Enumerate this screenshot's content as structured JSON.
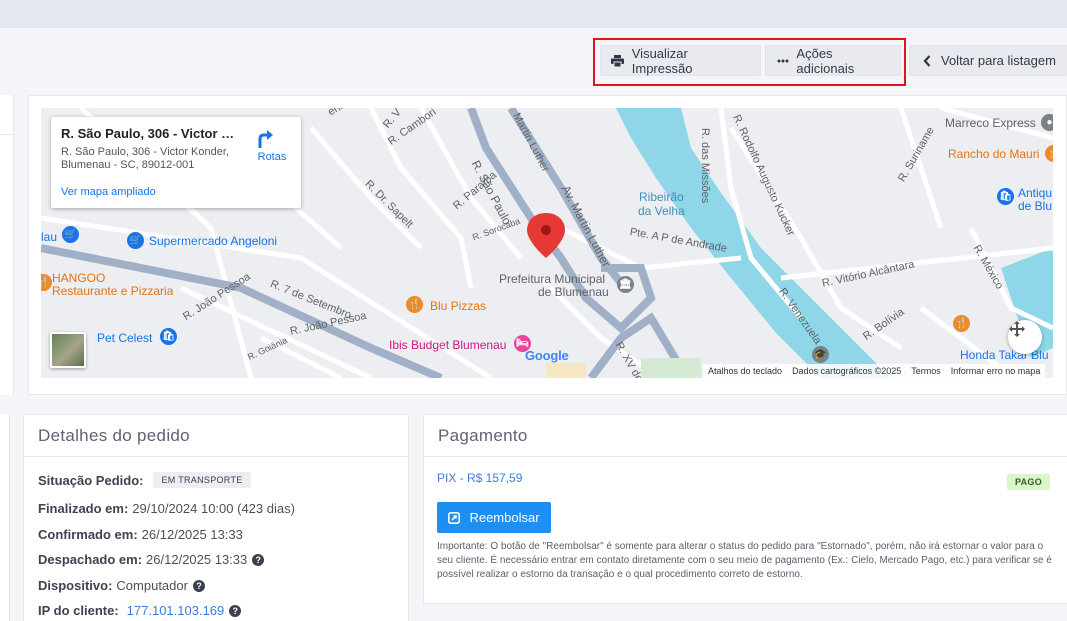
{
  "toolbar": {
    "print_label": "Visualizar Impressão",
    "actions_label": "Ações adicionais",
    "back_label": "Voltar para listagem",
    "highlight_color": "#e0121b"
  },
  "map": {
    "info": {
      "title": "R. São Paulo, 306 - Victor Kon...",
      "address": "R. São Paulo, 306 - Victor Konder, Blumenau - SC, 89012-001",
      "larger_map_link": "Ver mapa ampliado",
      "route_label": "Rotas"
    },
    "labels": {
      "supermercado": "Supermercado Angeloni",
      "hangoo_1": "HANGOO",
      "hangoo_2": "Restaurante e Pizzaria",
      "pet": "Pet Celest",
      "blu_pizzas": "Blu Pizzas",
      "ibis": "Ibis Budget Blumenau",
      "prefeitura_1": "Prefeitura Municipal",
      "prefeitura_2": "de Blumenau",
      "ribeirao_1": "Ribeirão",
      "ribeirao_2": "da Velha",
      "marreco": "Marreco Express",
      "rancho": "Rancho do Mauri",
      "antiq_1": "Antiqu",
      "antiq_2": "de Blu",
      "honda": "Honda Takar Blu",
      "lau": "lau"
    },
    "streets": {
      "sao_paulo": "R. São Paulo",
      "martin": "Av. Martin Luther",
      "martin2": "Martin Luther",
      "ap_andrade": "Pte. A P de Andrade",
      "sete_setembro": "R. 7 de Setembro",
      "joao_pessoa": "R. João Pessoa",
      "joao_pessoa2": "R. João Pessoa",
      "goiania": "R. Goiânia",
      "sorocaba": "R. Sorocaba",
      "paraiba": "R. Paraíba",
      "sapelt": "R. Dr. Sapelt",
      "cambori": "R. Cambori",
      "missoes": "R. das Missões",
      "rodolfo": "R. Rodolfo Augusto Kucker",
      "vitorio": "R. Vitório Alcântara",
      "venezuela": "R. Venezuela",
      "bolivia": "R. Bolívia",
      "suriname": "R. Suriname",
      "mexico": "R. México",
      "xv": "R. XV de",
      "hering": "ering",
      "rv": "R. V"
    },
    "google": "Google",
    "attribution": {
      "shortcuts": "Atalhos do teclado",
      "data": "Dados cartográficos ©2025",
      "terms": "Termos",
      "report": "Informar erro no mapa"
    }
  },
  "details": {
    "title": "Detalhes do pedido",
    "status_label": "Situação Pedido:",
    "status_value": "EM TRANSPORTE",
    "finalized_label": "Finalizado em:",
    "finalized_value": "29/10/2024 10:00 (423 dias)",
    "confirmed_label": "Confirmado em:",
    "confirmed_value": "26/12/2025 13:33",
    "dispatched_label": "Despachado em:",
    "dispatched_value": "26/12/2025 13:33",
    "device_label": "Dispositivo:",
    "device_value": "Computador",
    "ip_label": "IP do cliente:",
    "ip_value": "177.101.103.169",
    "help_glyph": "?"
  },
  "payment": {
    "title": "Pagamento",
    "method": "PIX - R$ 157,59",
    "status_badge": "PAGO",
    "refund_label": "Reembolsar",
    "note": "Importante: O botão de \"Reembolsar\" é somente para alterar o status do pedido para \"Estornado\", porém, não irá estornar o valor para o seu cliente. É necessário entrar em contato diretamente com o seu meio de pagamento (Ex.: Cielo, Mercado Pago, etc.) para verificar se é possível realizar o estorno da transação e o qual procedimento correto de estorno."
  }
}
